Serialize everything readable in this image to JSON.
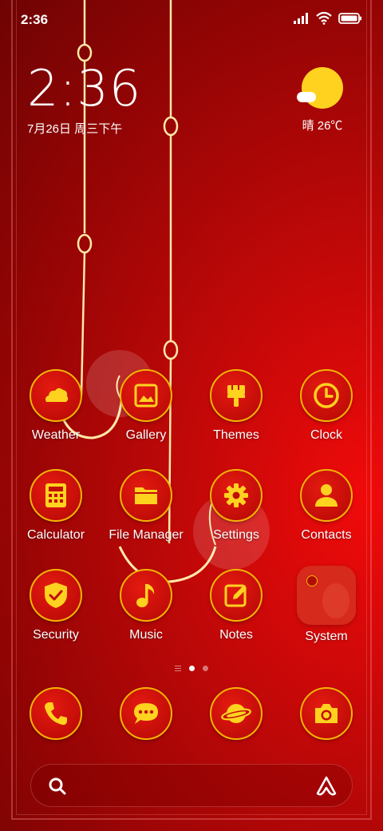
{
  "status_bar": {
    "time": "2:36"
  },
  "clock_widget": {
    "time": "2:36",
    "date": "7月26日 周三下午"
  },
  "weather_widget": {
    "text": "晴 26℃"
  },
  "apps": [
    {
      "label": "Weather",
      "icon": "weather-icon"
    },
    {
      "label": "Gallery",
      "icon": "gallery-icon"
    },
    {
      "label": "Themes",
      "icon": "paintbrush-icon"
    },
    {
      "label": "Clock",
      "icon": "clock-icon"
    },
    {
      "label": "Calculator",
      "icon": "calculator-icon"
    },
    {
      "label": "File Manager",
      "icon": "folder-icon"
    },
    {
      "label": "Settings",
      "icon": "gear-icon"
    },
    {
      "label": "Contacts",
      "icon": "person-icon"
    },
    {
      "label": "Security",
      "icon": "shield-check-icon"
    },
    {
      "label": "Music",
      "icon": "music-note-icon"
    },
    {
      "label": "Notes",
      "icon": "notes-pen-icon"
    },
    {
      "label": "System",
      "icon": "folder-icon"
    }
  ],
  "dock": [
    {
      "icon": "phone-icon"
    },
    {
      "icon": "message-icon"
    },
    {
      "icon": "planet-browser-icon"
    },
    {
      "icon": "camera-icon"
    }
  ],
  "page_indicator": {
    "pages": 2,
    "current": 1
  },
  "colors": {
    "background": "#c10808",
    "icon_fill": "#c30d08",
    "accent": "#ffd21f",
    "ring": "#f4b400"
  }
}
